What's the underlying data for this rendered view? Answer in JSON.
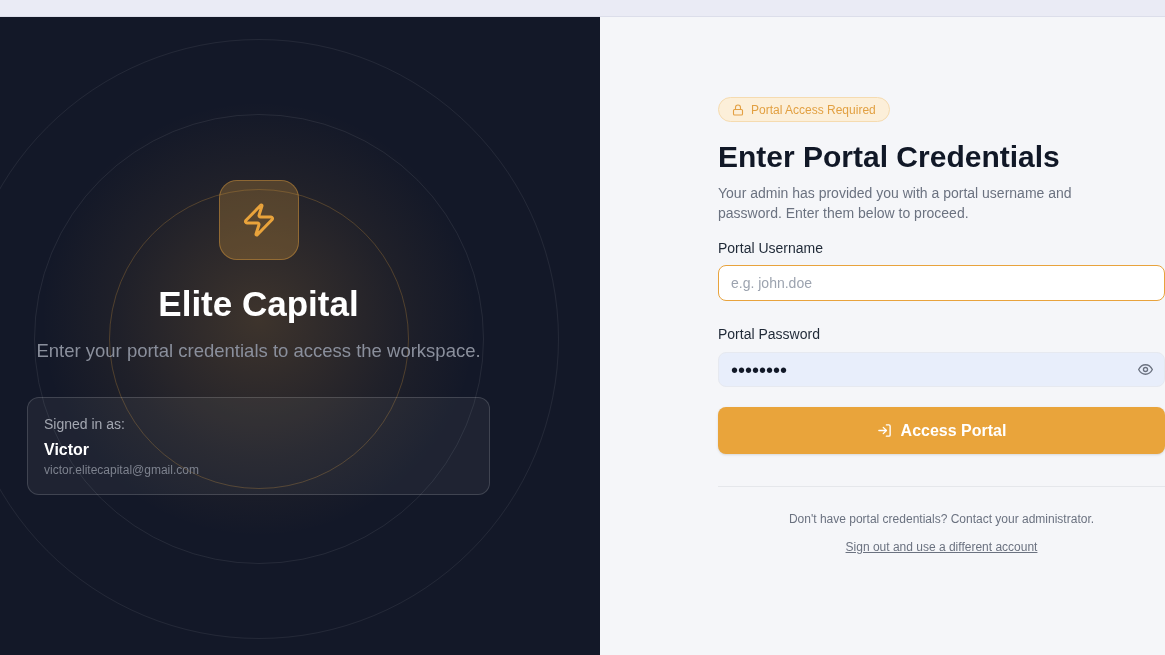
{
  "brand": {
    "name": "Elite Capital",
    "tagline": "Enter your portal credentials to access the workspace."
  },
  "account_card": {
    "label": "Signed in as:",
    "name": "Victor",
    "email": "victor.elitecapital@gmail.com"
  },
  "badge": {
    "label": "Portal Access Required"
  },
  "heading": "Enter Portal Credentials",
  "description": "Your admin has provided you with a portal username and password. Enter them below to proceed.",
  "fields": [
    {
      "kind": "text",
      "label": "Portal Username",
      "placeholder": "e.g. john.doe",
      "focused": true,
      "autofilled": false
    },
    {
      "kind": "password",
      "label": "Portal Password",
      "value": "••••••••",
      "focused": false,
      "autofilled": true
    }
  ],
  "submit_button": {
    "label": "Access Portal"
  },
  "footer": {
    "note": "Don't have portal credentials? Contact your administrator.",
    "link": "Sign out and use a different account"
  }
}
